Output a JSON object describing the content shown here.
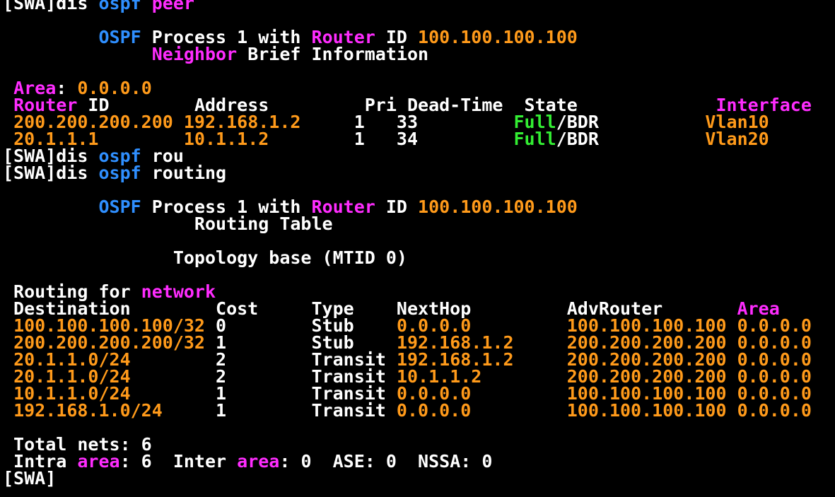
{
  "window": {
    "background": "#000000",
    "colors": {
      "white": "#ffffff",
      "keyword_blue": "#2f8fff",
      "keyword_magenta": "#ff2cff",
      "value_orange": "#ff9a1a",
      "state_green": "#33ee33"
    }
  },
  "lines": [
    {
      "segments": [
        {
          "t": "[SWA]dis ",
          "c": "w"
        },
        {
          "t": "ospf",
          "c": "b"
        },
        {
          "t": " ",
          "c": "w"
        },
        {
          "t": "peer",
          "c": "m"
        }
      ]
    },
    {
      "segments": []
    },
    {
      "segments": [
        {
          "t": "         ",
          "c": "w"
        },
        {
          "t": "OSPF",
          "c": "b"
        },
        {
          "t": " Process 1 with ",
          "c": "w"
        },
        {
          "t": "Router",
          "c": "m"
        },
        {
          "t": " ID ",
          "c": "w"
        },
        {
          "t": "100.100.100.100",
          "c": "o"
        }
      ]
    },
    {
      "segments": [
        {
          "t": "              ",
          "c": "w"
        },
        {
          "t": "Neighbor",
          "c": "m"
        },
        {
          "t": " Brief Information",
          "c": "w"
        }
      ]
    },
    {
      "segments": []
    },
    {
      "segments": [
        {
          "t": " ",
          "c": "w"
        },
        {
          "t": "Area",
          "c": "m"
        },
        {
          "t": ": ",
          "c": "w"
        },
        {
          "t": "0.0.0.0",
          "c": "o"
        }
      ]
    },
    {
      "segments": [
        {
          "t": " ",
          "c": "w"
        },
        {
          "t": "Router",
          "c": "m"
        },
        {
          "t": " ID        Address         Pri Dead-Time  State             ",
          "c": "w"
        },
        {
          "t": "Interface",
          "c": "m"
        }
      ]
    },
    {
      "segments": [
        {
          "t": " ",
          "c": "w"
        },
        {
          "t": "200.200.200.200 192.168.1.2",
          "c": "o"
        },
        {
          "t": "     1   33         ",
          "c": "w"
        },
        {
          "t": "Full",
          "c": "g"
        },
        {
          "t": "/BDR          ",
          "c": "w"
        },
        {
          "t": "Vlan10",
          "c": "o"
        }
      ]
    },
    {
      "segments": [
        {
          "t": " ",
          "c": "w"
        },
        {
          "t": "20.1.1.1        10.1.1.2",
          "c": "o"
        },
        {
          "t": "        1   34         ",
          "c": "w"
        },
        {
          "t": "Full",
          "c": "g"
        },
        {
          "t": "/BDR          ",
          "c": "w"
        },
        {
          "t": "Vlan20",
          "c": "o"
        }
      ]
    },
    {
      "segments": [
        {
          "t": "[SWA]dis ",
          "c": "w"
        },
        {
          "t": "ospf",
          "c": "b"
        },
        {
          "t": " rou",
          "c": "w"
        }
      ]
    },
    {
      "segments": [
        {
          "t": "[SWA]dis ",
          "c": "w"
        },
        {
          "t": "ospf",
          "c": "b"
        },
        {
          "t": " routing",
          "c": "w"
        }
      ]
    },
    {
      "segments": []
    },
    {
      "segments": [
        {
          "t": "         ",
          "c": "w"
        },
        {
          "t": "OSPF",
          "c": "b"
        },
        {
          "t": " Process 1 with ",
          "c": "w"
        },
        {
          "t": "Router",
          "c": "m"
        },
        {
          "t": " ID ",
          "c": "w"
        },
        {
          "t": "100.100.100.100",
          "c": "o"
        }
      ]
    },
    {
      "segments": [
        {
          "t": "                  Routing Table",
          "c": "w"
        }
      ]
    },
    {
      "segments": []
    },
    {
      "segments": [
        {
          "t": "                Topology base (MTID 0)",
          "c": "w"
        }
      ]
    },
    {
      "segments": []
    },
    {
      "segments": [
        {
          "t": " Routing for ",
          "c": "w"
        },
        {
          "t": "network",
          "c": "m"
        }
      ]
    },
    {
      "segments": [
        {
          "t": " Destination        Cost     Type    NextHop         AdvRouter       ",
          "c": "w"
        },
        {
          "t": "Area",
          "c": "m"
        }
      ]
    },
    {
      "segments": [
        {
          "t": " ",
          "c": "w"
        },
        {
          "t": "100.100.100.100/32",
          "c": "o"
        },
        {
          "t": " 0        Stub    ",
          "c": "w"
        },
        {
          "t": "0.0.0.0         100.100.100.100 0.0.0.0",
          "c": "o"
        }
      ]
    },
    {
      "segments": [
        {
          "t": " ",
          "c": "w"
        },
        {
          "t": "200.200.200.200/32",
          "c": "o"
        },
        {
          "t": " 1        Stub    ",
          "c": "w"
        },
        {
          "t": "192.168.1.2     200.200.200.200 0.0.0.0",
          "c": "o"
        }
      ]
    },
    {
      "segments": [
        {
          "t": " ",
          "c": "w"
        },
        {
          "t": "20.1.1.0/24",
          "c": "o"
        },
        {
          "t": "        2        Transit ",
          "c": "w"
        },
        {
          "t": "192.168.1.2     200.200.200.200 0.0.0.0",
          "c": "o"
        }
      ]
    },
    {
      "segments": [
        {
          "t": " ",
          "c": "w"
        },
        {
          "t": "20.1.1.0/24",
          "c": "o"
        },
        {
          "t": "        2        Transit ",
          "c": "w"
        },
        {
          "t": "10.1.1.2        200.200.200.200 0.0.0.0",
          "c": "o"
        }
      ]
    },
    {
      "segments": [
        {
          "t": " ",
          "c": "w"
        },
        {
          "t": "10.1.1.0/24",
          "c": "o"
        },
        {
          "t": "        1        Transit ",
          "c": "w"
        },
        {
          "t": "0.0.0.0         100.100.100.100 0.0.0.0",
          "c": "o"
        }
      ]
    },
    {
      "segments": [
        {
          "t": " ",
          "c": "w"
        },
        {
          "t": "192.168.1.0/24",
          "c": "o"
        },
        {
          "t": "     1        Transit ",
          "c": "w"
        },
        {
          "t": "0.0.0.0         100.100.100.100 0.0.0.0",
          "c": "o"
        }
      ]
    },
    {
      "segments": []
    },
    {
      "segments": [
        {
          "t": " Total nets: 6",
          "c": "w"
        }
      ]
    },
    {
      "segments": [
        {
          "t": " Intra ",
          "c": "w"
        },
        {
          "t": "area",
          "c": "m"
        },
        {
          "t": ": 6  Inter ",
          "c": "w"
        },
        {
          "t": "area",
          "c": "m"
        },
        {
          "t": ": 0  ASE: 0  NSSA: 0",
          "c": "w"
        }
      ]
    },
    {
      "segments": [
        {
          "t": "[SWA]",
          "c": "w"
        }
      ]
    }
  ]
}
